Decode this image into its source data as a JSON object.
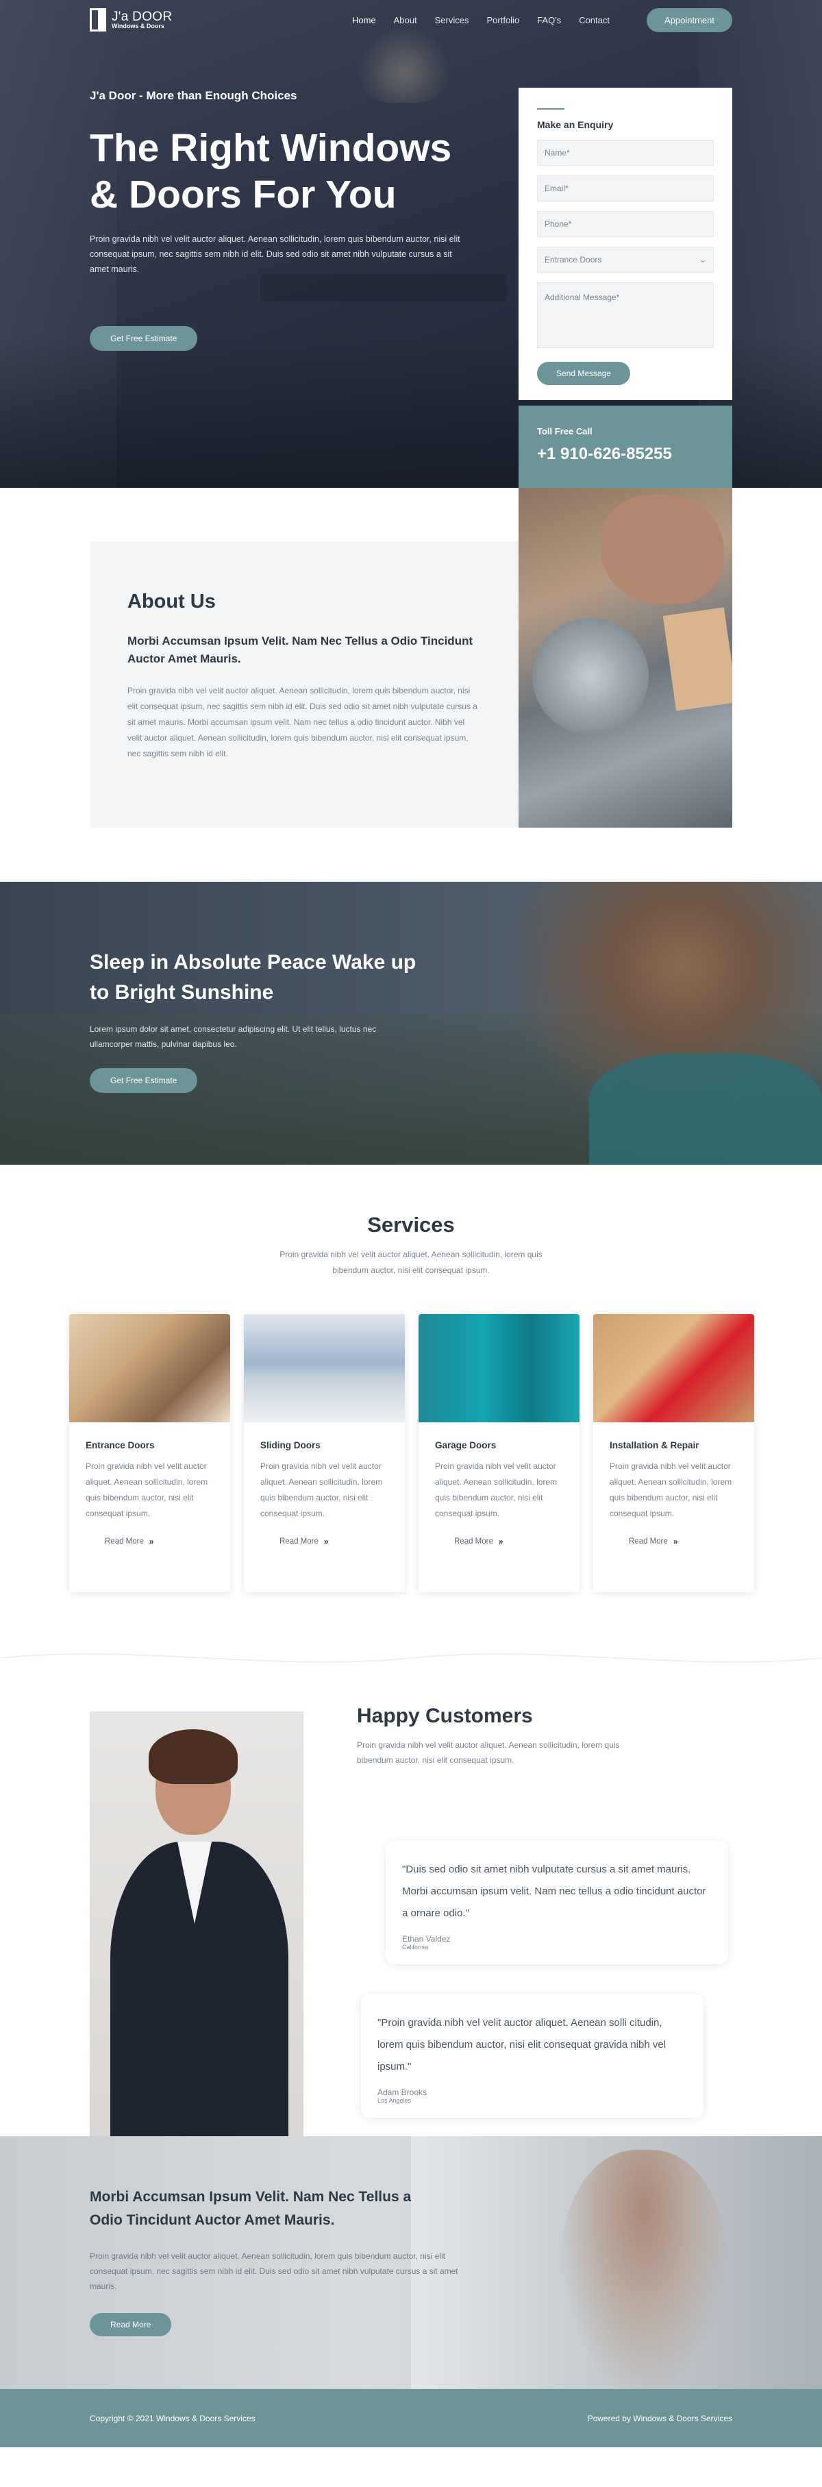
{
  "nav": {
    "logo_line1": "J'a DOOR",
    "logo_line2": "Windows & Doors",
    "items": [
      "Home",
      "About",
      "Services",
      "Portfolio",
      "FAQ's",
      "Contact"
    ],
    "cta": "Appointment"
  },
  "hero": {
    "kicker": "J'a Door - More than Enough Choices",
    "title_line1": "The Right Windows",
    "title_line2": "& Doors For You",
    "text": "Proin gravida nibh vel velit auctor aliquet. Aenean sollicitudin, lorem quis bibendum auctor, nisi elit consequat ipsum, nec sagittis sem nibh id elit. Duis sed odio sit amet nibh vulputate cursus a sit amet mauris.",
    "button": "Get Free Estimate"
  },
  "enquiry": {
    "title": "Make an Enquiry",
    "name_placeholder": "Name*",
    "email_placeholder": "Email*",
    "phone_placeholder": "Phone*",
    "select_value": "Entrance Doors",
    "message_placeholder": "Additional Message*",
    "button": "Send Message"
  },
  "tollfree": {
    "label": "Toll Free Call",
    "number": "+1 910-626-85255"
  },
  "about": {
    "title": "About Us",
    "subtitle": "Morbi Accumsan Ipsum Velit. Nam Nec Tellus a Odio Tincidunt Auctor Amet Mauris.",
    "text": "Proin gravida nibh vel velit auctor aliquet. Aenean sollicitudin, lorem quis bibendum auctor, nisi elit consequat ipsum, nec sagittis sem nibh id elit. Duis sed odio sit amet nibh vulputate cursus a sit amet mauris. Morbi accumsan ipsum velit. Nam nec tellus a odio tincidunt auctor. Nibh vel velit auctor aliquet. Aenean sollicitudin, lorem quis bibendum auctor, nisi elit consequat ipsum, nec sagittis sem nibh id elit."
  },
  "sleep": {
    "title_line1": "Sleep in Absolute Peace Wake up",
    "title_line2": "to Bright Sunshine",
    "text": "Lorem ipsum dolor sit amet, consectetur adipiscing elit. Ut elit tellus, luctus nec ullamcorper mattis, pulvinar dapibus leo.",
    "button": "Get Free Estimate"
  },
  "services": {
    "title": "Services",
    "text": "Proin gravida nibh vel velit auctor aliquet. Aenean sollicitudin, lorem quis bibendum auctor, nisi elit consequat ipsum.",
    "read_more": "Read More",
    "cards": [
      {
        "title": "Entrance Doors",
        "text": "Proin gravida nibh vel velit auctor aliquet. Aenean sollicitudin, lorem quis bibendum auctor, nisi elit consequat ipsum."
      },
      {
        "title": "Sliding Doors",
        "text": "Proin gravida nibh vel velit auctor aliquet. Aenean sollicitudin, lorem quis bibendum auctor, nisi elit consequat ipsum."
      },
      {
        "title": "Garage Doors",
        "text": "Proin gravida nibh vel velit auctor aliquet. Aenean sollicitudin, lorem quis bibendum auctor, nisi elit consequat ipsum."
      },
      {
        "title": "Installation & Repair",
        "text": "Proin gravida nibh vel velit auctor aliquet. Aenean sollicitudin, lorem quis bibendum auctor, nisi elit consequat ipsum."
      }
    ]
  },
  "testimonials": {
    "title": "Happy Customers",
    "text": "Proin gravida nibh vel velit auctor aliquet. Aenean sollicitudin, lorem quis bibendum auctor, nisi elit consequat ipsum.",
    "items": [
      {
        "quote": "\"Duis sed odio sit amet nibh vulputate cursus a sit amet mauris. Morbi accumsan ipsum velit. Nam nec tellus a odio tincidunt auctor a ornare odio.\"",
        "name": "Ethan Valdez",
        "location": "California"
      },
      {
        "quote": "\"Proin gravida nibh vel velit auctor aliquet. Aenean solli citudin, lorem quis bibendum auctor, nisi elit consequat gravida nibh vel ipsum.\"",
        "name": "Adam Brooks",
        "location": "Los Angeles"
      }
    ]
  },
  "cta": {
    "title_line1": "Morbi Accumsan Ipsum Velit. Nam Nec Tellus a",
    "title_line2": "Odio Tincidunt Auctor Amet Mauris.",
    "text": "Proin gravida nibh vel velit auctor aliquet. Aenean sollicitudin, lorem quis bibendum auctor, nisi elit consequat ipsum, nec sagittis sem nibh id elit. Duis sed odio sit amet nibh vulputate cursus a sit amet mauris.",
    "button": "Read More"
  },
  "footer": {
    "copyright": "Copyright © 2021 Windows & Doors Services",
    "powered": "Powered by Windows & Doors Services"
  },
  "colors": {
    "accent": "#6b9598",
    "dark_text": "#2d3a45",
    "muted_text": "#7a8591"
  },
  "icons": {
    "logo": "door-logo-icon",
    "read_more": "double-chevron-right-icon",
    "select": "chevron-down-icon"
  }
}
